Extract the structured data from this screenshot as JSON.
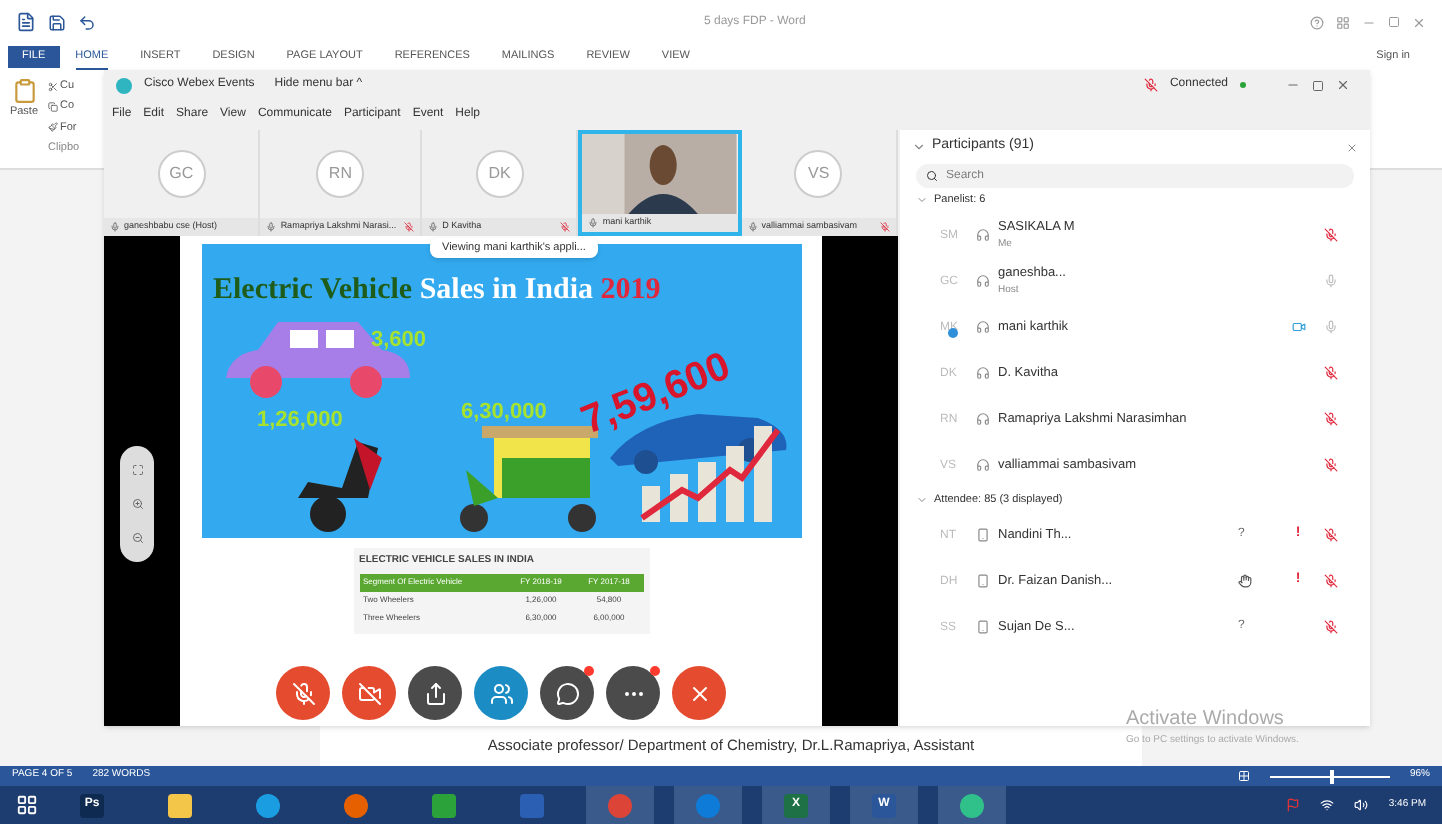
{
  "word": {
    "title": "5 days FDP - Word",
    "file_tab": "FILE",
    "tabs": [
      {
        "label": "HOME",
        "selected": true
      },
      {
        "label": "INSERT",
        "selected": false
      },
      {
        "label": "DESIGN",
        "selected": false
      },
      {
        "label": "PAGE LAYOUT",
        "selected": false
      },
      {
        "label": "REFERENCES",
        "selected": false
      },
      {
        "label": "MAILINGS",
        "selected": false
      },
      {
        "label": "REVIEW",
        "selected": false
      },
      {
        "label": "VIEW",
        "selected": false
      }
    ],
    "sign_in": "Sign in",
    "paste": "Paste",
    "clipboard_items": [
      "Cu",
      "Co",
      "For"
    ],
    "clipboard_group": "Clipbo",
    "document_line": "Associate professor/ Department of Chemistry, Dr.L.Ramapriya, Assistant"
  },
  "webex": {
    "title": "Cisco Webex Events",
    "hide_menu": "Hide menu bar ^",
    "status": "Connected",
    "menu": [
      "File",
      "Edit",
      "Share",
      "View",
      "Communicate",
      "Participant",
      "Event",
      "Help"
    ],
    "tiles": [
      {
        "kind": "avatar",
        "initials": "GC",
        "name": "ganeshbabu cse (Host)",
        "muted": false
      },
      {
        "kind": "avatar",
        "initials": "RN",
        "name": "Ramapriya Lakshmi Narasi...",
        "muted": true
      },
      {
        "kind": "avatar",
        "initials": "DK",
        "name": "D Kavitha",
        "muted": true
      },
      {
        "kind": "video",
        "name": "mani karthik",
        "muted": false
      },
      {
        "kind": "avatar",
        "initials": "VS",
        "name": "valliammai sambasivam",
        "muted": true
      }
    ],
    "toast": "Viewing mani karthik's appli...",
    "slide": {
      "title": [
        {
          "text": "Electric Vehicle ",
          "kind": "dark"
        },
        {
          "text": "Sales in India ",
          "kind": "light"
        },
        {
          "text": "2019",
          "kind": "accent"
        }
      ],
      "figures": [
        {
          "text": "3,600",
          "kind": "green"
        },
        {
          "text": "1,26,000",
          "kind": "green"
        },
        {
          "text": "6,30,000",
          "kind": "green"
        },
        {
          "text": "7,59,600",
          "kind": "red"
        }
      ],
      "table": {
        "title": "ELECTRIC VEHICLE SALES IN INDIA",
        "columns": [
          "Segment Of Electric Vehicle",
          "FY 2018-19",
          "FY 2017-18"
        ],
        "rows": [
          [
            "Two Wheelers",
            "1,26,000",
            "54,800"
          ],
          [
            "Three Wheelers",
            "6,30,000",
            "6,00,000"
          ]
        ]
      }
    },
    "controls": [
      {
        "kind": "mic",
        "alert": false
      },
      {
        "kind": "camera",
        "alert": false
      },
      {
        "kind": "share",
        "alert": false
      },
      {
        "kind": "participants",
        "alert": false
      },
      {
        "kind": "chat",
        "alert": true
      },
      {
        "kind": "more",
        "alert": true
      },
      {
        "kind": "leave",
        "alert": false
      }
    ],
    "participants": {
      "title": "Participants (91)",
      "search_placeholder": "Search",
      "groups": [
        {
          "label": "Panelist: 6",
          "expanded": true,
          "rows": [
            {
              "kind": "panelist",
              "initials": "SM",
              "name": "SASIKALA M",
              "role": "Me",
              "muted": true,
              "video": false,
              "hand": false,
              "presenter": false
            },
            {
              "kind": "panelist",
              "initials": "GC",
              "name": "ganeshba...",
              "role": "Host",
              "muted": false,
              "video": false,
              "hand": false,
              "presenter": false
            },
            {
              "kind": "panelist",
              "initials": "MK",
              "name": "mani karthik",
              "muted": false,
              "video": true,
              "hand": false,
              "presenter": true
            },
            {
              "kind": "panelist",
              "initials": "DK",
              "name": "D. Kavitha",
              "muted": true,
              "video": false,
              "hand": false,
              "presenter": false
            },
            {
              "kind": "panelist",
              "initials": "RN",
              "name": "Ramapriya Lakshmi Narasimhan",
              "muted": true,
              "video": false,
              "hand": false,
              "presenter": false
            },
            {
              "kind": "panelist",
              "initials": "VS",
              "name": "valliammai sambasivam",
              "muted": true,
              "video": false,
              "hand": false,
              "presenter": false
            }
          ]
        },
        {
          "label": "Attendee: 85 (3 displayed)",
          "expanded": true,
          "rows": [
            {
              "kind": "attendee",
              "initials": "NT",
              "name": "Nandini Th...",
              "muted": true,
              "video": false,
              "hand": false,
              "question_mark": "?",
              "alert_mark": "!",
              "presenter": false
            },
            {
              "kind": "attendee",
              "initials": "DH",
              "name": "Dr. Faizan Danish...",
              "muted": true,
              "video": false,
              "hand": true,
              "alert_mark": "!",
              "presenter": false
            },
            {
              "kind": "attendee",
              "initials": "SS",
              "name": "Sujan De S...",
              "muted": true,
              "video": false,
              "hand": false,
              "question_mark": "?",
              "presenter": false
            }
          ]
        }
      ]
    }
  },
  "activation": {
    "title": "Activate Windows",
    "hint": "Go to PC settings to activate Windows."
  },
  "status_bar": {
    "page": "PAGE 4 OF 5",
    "words": "282 WORDS",
    "zoom": "96%",
    "level": 0.5
  },
  "taskbar": {
    "apps": [
      {
        "kind": "ps",
        "label": "Ps",
        "active": false
      },
      {
        "kind": "folder",
        "active": false
      },
      {
        "kind": "ie",
        "active": false
      },
      {
        "kind": "firefox",
        "active": false
      },
      {
        "kind": "store",
        "active": false
      },
      {
        "kind": "network",
        "active": false
      },
      {
        "kind": "chrome",
        "active": true
      },
      {
        "kind": "edge",
        "active": true
      },
      {
        "kind": "excel",
        "label": "X",
        "active": true
      },
      {
        "kind": "word",
        "label": "W",
        "active": true
      },
      {
        "kind": "webex",
        "active": true
      }
    ],
    "time": "3:46 PM"
  }
}
